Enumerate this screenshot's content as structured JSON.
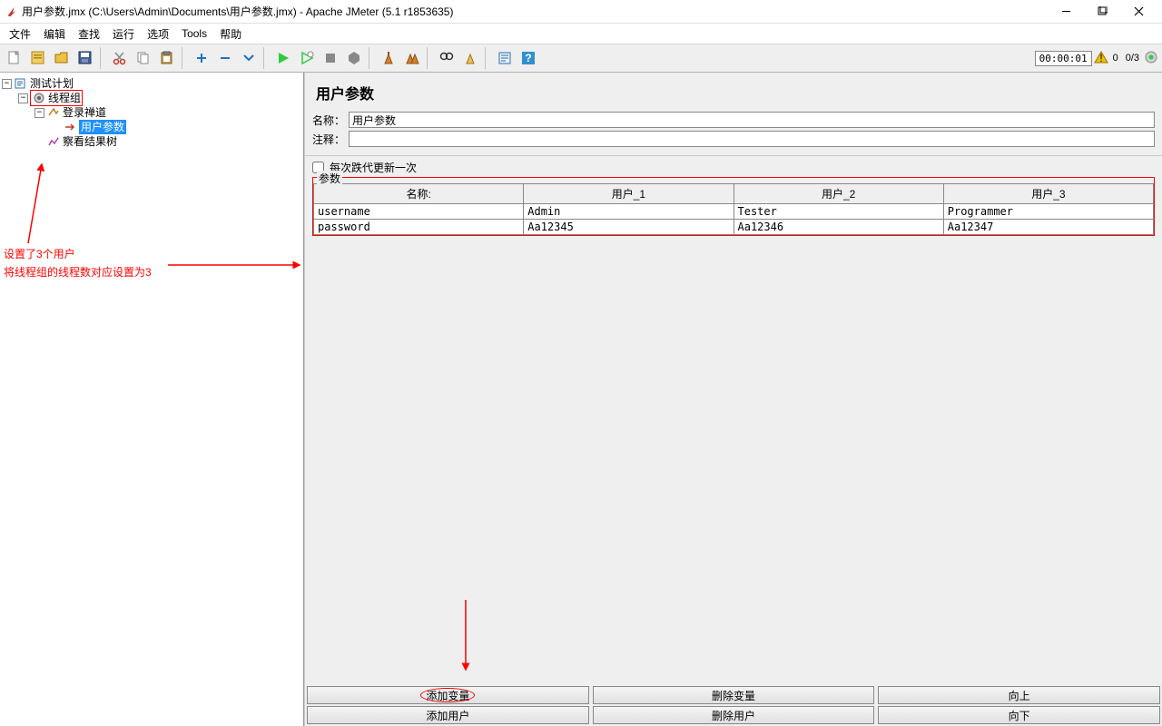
{
  "window": {
    "title": "用户参数.jmx (C:\\Users\\Admin\\Documents\\用户参数.jmx) - Apache JMeter (5.1 r1853635)"
  },
  "menu": {
    "file": "文件",
    "edit": "编辑",
    "search": "查找",
    "run": "运行",
    "options": "选项",
    "tools": "Tools",
    "help": "帮助"
  },
  "toolbar": {
    "time": "00:00:01",
    "threads": "0/3"
  },
  "tree": {
    "root": "测试计划",
    "thread_group": "线程组",
    "sampler": "登录禅道",
    "user_params": "用户参数",
    "view_results": "察看结果树"
  },
  "annotation": {
    "line1": "设置了3个用户",
    "line2": "将线程组的线程数对应设置为3"
  },
  "panel": {
    "title": "用户参数",
    "name_label": "名称：",
    "name_value": "用户参数",
    "comment_label": "注释：",
    "comment_value": "",
    "update_per_iter": "每次跌代更新一次",
    "params_label": "参数",
    "columns": {
      "name": "名称:",
      "u1": "用户_1",
      "u2": "用户_2",
      "u3": "用户_3"
    },
    "rows": [
      {
        "name": "username",
        "u1": "Admin",
        "u2": "Tester",
        "u3": "Programmer"
      },
      {
        "name": "password",
        "u1": "Aa12345",
        "u2": "Aa12346",
        "u3": "Aa12347"
      }
    ],
    "buttons": {
      "add_var": "添加变量",
      "del_var": "删除变量",
      "up": "向上",
      "add_user": "添加用户",
      "del_user": "删除用户",
      "down": "向下"
    }
  },
  "status": {
    "errors": "0"
  }
}
